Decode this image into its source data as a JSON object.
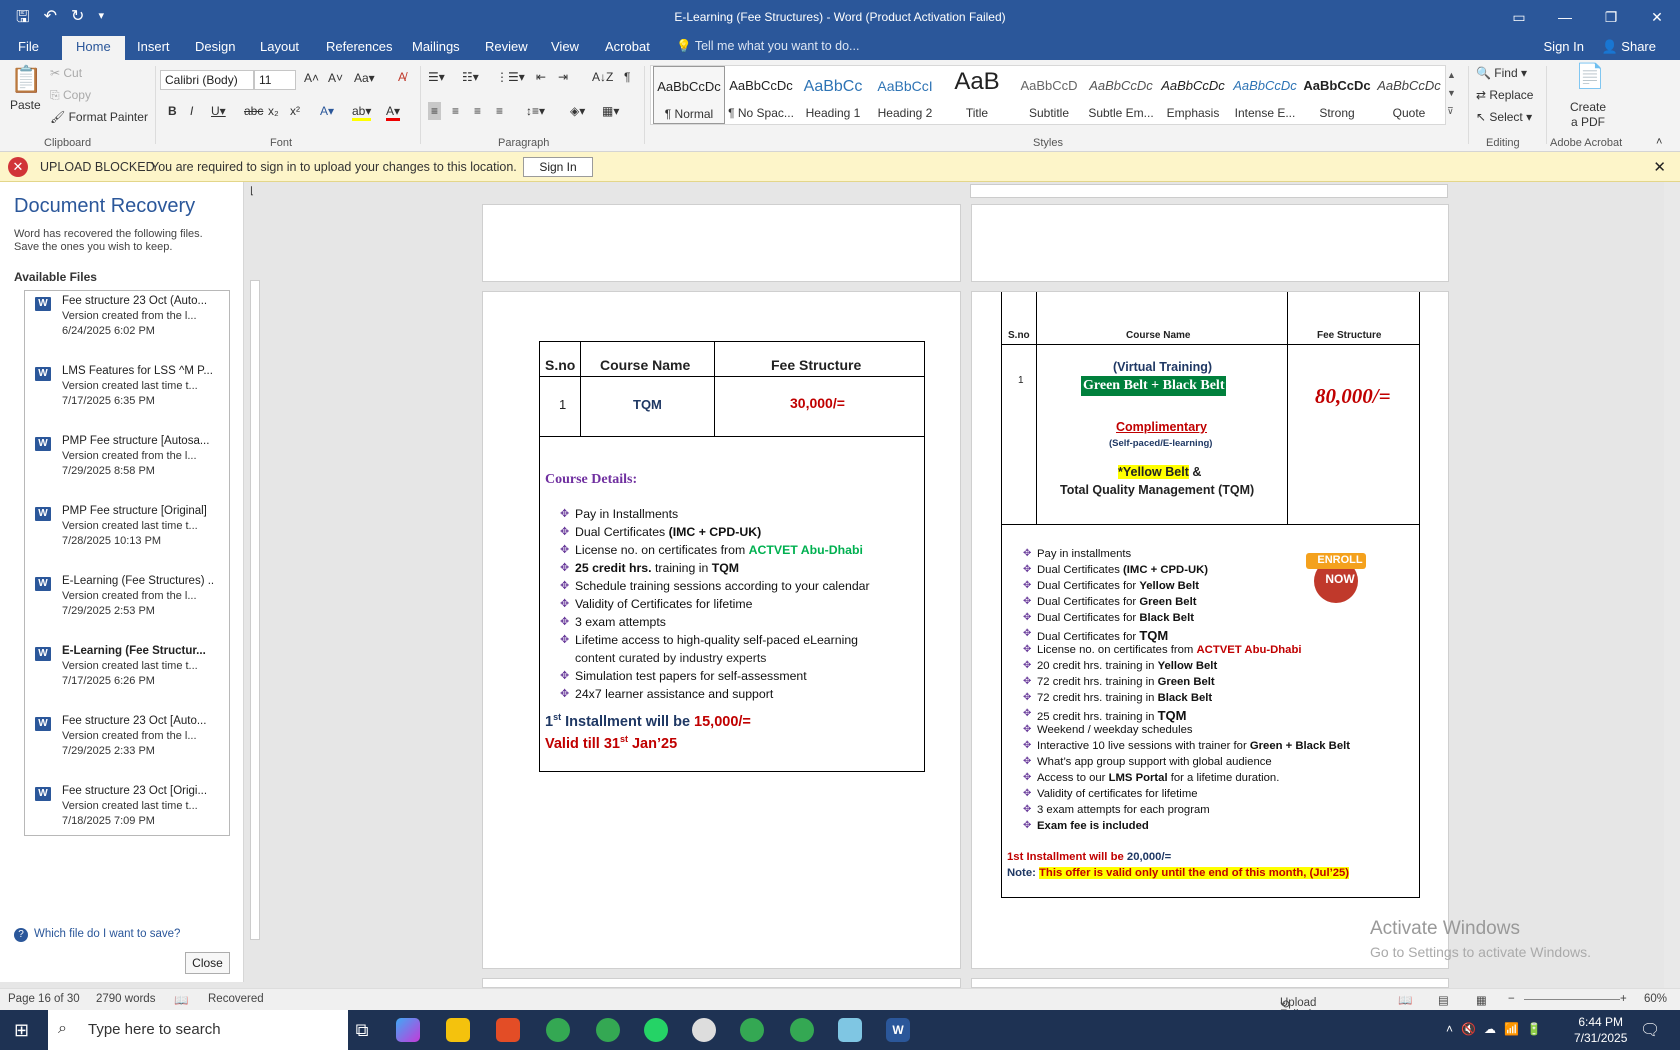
{
  "window": {
    "title": "E-Learning (Fee Structures) - Word (Product Activation Failed)"
  },
  "tabs": [
    "File",
    "Home",
    "Insert",
    "Design",
    "Layout",
    "References",
    "Mailings",
    "Review",
    "View",
    "Acrobat"
  ],
  "tell_me": "Tell me what you want to do...",
  "sign_in": "Sign In",
  "share": "Share",
  "clipboard": {
    "paste": "Paste",
    "cut": "Cut",
    "copy": "Copy",
    "format_painter": "Format Painter",
    "label": "Clipboard"
  },
  "font": {
    "name": "Calibri (Body)",
    "size": "11",
    "label": "Font"
  },
  "paragraph": {
    "label": "Paragraph"
  },
  "styles": {
    "label": "Styles",
    "items": [
      {
        "preview": "AaBbCcDc",
        "name": "¶ Normal"
      },
      {
        "preview": "AaBbCcDc",
        "name": "¶ No Spac..."
      },
      {
        "preview": "AaBbCc",
        "name": "Heading 1"
      },
      {
        "preview": "AaBbCcI",
        "name": "Heading 2"
      },
      {
        "preview": "AaB",
        "name": "Title"
      },
      {
        "preview": "AaBbCcD",
        "name": "Subtitle"
      },
      {
        "preview": "AaBbCcDc",
        "name": "Subtle Em..."
      },
      {
        "preview": "AaBbCcDc",
        "name": "Emphasis"
      },
      {
        "preview": "AaBbCcDc",
        "name": "Intense E..."
      },
      {
        "preview": "AaBbCcDc",
        "name": "Strong"
      },
      {
        "preview": "AaBbCcDc",
        "name": "Quote"
      }
    ]
  },
  "editing": {
    "find": "Find",
    "replace": "Replace",
    "select": "Select",
    "label": "Editing"
  },
  "acrobat": {
    "create_line1": "Create",
    "create_line2": "a PDF",
    "label": "Adobe Acrobat"
  },
  "message_bar": {
    "title": "UPLOAD BLOCKED",
    "text": "You are required to sign in to upload your changes to this location.",
    "button": "Sign In"
  },
  "recovery": {
    "title": "Document Recovery",
    "description": "Word has recovered the following files. Save the ones you wish to keep.",
    "available": "Available Files",
    "files": [
      {
        "name": "Fee structure 23 Oct (Auto...",
        "line2": "Version created from the l...",
        "date": "6/24/2025 6:02 PM",
        "bold": false
      },
      {
        "name": "LMS Features for LSS ^M P...",
        "line2": "Version created last time t...",
        "date": "7/17/2025 6:35 PM",
        "bold": false
      },
      {
        "name": "PMP Fee structure  [Autosa...",
        "line2": "Version created from the l...",
        "date": "7/29/2025 8:58 PM",
        "bold": false
      },
      {
        "name": "PMP Fee structure  [Original]",
        "line2": "Version created last time t...",
        "date": "7/28/2025 10:13 PM",
        "bold": false
      },
      {
        "name": "E-Learning (Fee Structures) ..",
        "line2": "Version created from the l...",
        "date": "7/29/2025 2:53 PM",
        "bold": false
      },
      {
        "name": "E-Learning (Fee Structur...",
        "line2": "Version created last time t...",
        "date": "7/17/2025 6:26 PM",
        "bold": true
      },
      {
        "name": "Fee structure 23 Oct  [Auto...",
        "line2": "Version created from the l...",
        "date": "7/29/2025 2:33 PM",
        "bold": false
      },
      {
        "name": "Fee structure 23 Oct  [Origi...",
        "line2": "Version created last time t...",
        "date": "7/18/2025 7:09 PM",
        "bold": false
      }
    ],
    "help": "Which file do I want to save?",
    "close": "Close"
  },
  "page_left": {
    "headers": [
      "S.no",
      "Course Name",
      "Fee Structure"
    ],
    "row": {
      "sno": "1",
      "course": "TQM",
      "fee": "30,000/="
    },
    "details_title": "Course Details:",
    "bullets": [
      "Pay in Installments",
      "Dual Certificates ",
      "License no. on certificates from ",
      "25 credit hrs.",
      "Schedule training sessions according to your calendar",
      "Validity of Certificates for lifetime",
      "3 exam attempts",
      "Lifetime access to high-quality self-paced eLearning",
      "content curated by industry experts",
      "Simulation test papers for self-assessment",
      "24x7 learner assistance and support"
    ],
    "dual_bold": "(IMC + CPD-UK)",
    "actvet": "ACTVET Abu-Dhabi",
    "credit_rest": " training in ",
    "credit_tqm": "TQM",
    "inst_1": "1",
    "inst_sup": "st",
    "inst_text": " Installment will be ",
    "inst_amount": "15,000/=",
    "valid_1": "Valid till 31",
    "valid_sup": "st",
    "valid_2": " Jan’25"
  },
  "page_right": {
    "headers": [
      "S.no",
      "Course Name",
      "Fee Structure"
    ],
    "sno": "1",
    "virtual": "(Virtual Training)",
    "belts": "Green Belt + Black Belt",
    "fee": "80,000/=",
    "complimentary": "Complimentary",
    "selfpaced": "(Self-paced/E-learning)",
    "yellow": "*Yellow Belt",
    "amp": " &",
    "tqm_line": "Total Quality Management (TQM)",
    "enroll_1": "ENROLL",
    "enroll_2": "NOW",
    "bullets": [
      {
        "a": "Pay in installments",
        "b": ""
      },
      {
        "a": "Dual Certificates ",
        "b": "(IMC + CPD-UK)"
      },
      {
        "a": "Dual Certificates for ",
        "b": "Yellow Belt"
      },
      {
        "a": "Dual Certificates for ",
        "b": "Green Belt"
      },
      {
        "a": "Dual Certificates for ",
        "b": "Black Belt"
      },
      {
        "a": "Dual Certificates for  ",
        "b": "TQM"
      },
      {
        "a": "License no. on certificates from ",
        "b": "ACTVET Abu-Dhabi"
      },
      {
        "a": "20 credit hrs. training in ",
        "b": "Yellow Belt"
      },
      {
        "a": "72 credit hrs. training in ",
        "b": "Green Belt"
      },
      {
        "a": "72 credit hrs. training in ",
        "b": "Black Belt"
      },
      {
        "a": "25 credit hrs. training in  ",
        "b": "TQM"
      },
      {
        "a": " Weekend / weekday schedules",
        "b": ""
      },
      {
        "a": "Interactive 10 live sessions with trainer for ",
        "b": "Green + Black Belt"
      },
      {
        "a": "What’s app group support with global audience",
        "b": ""
      },
      {
        "a": "Access to our ",
        "b": "LMS Portal"
      },
      {
        "a": "Validity of certificates for lifetime",
        "b": ""
      },
      {
        "a": "3 exam attempts for each program",
        "b": ""
      },
      {
        "a": "",
        "b": "Exam fee is included"
      }
    ],
    "lms_rest": " for a lifetime duration.",
    "inst_label": "1st Installment will be ",
    "inst_amount": "20,000/=",
    "note_label": "Note: ",
    "note_text": "This offer is valid only until the end of this month, (Jul’25)"
  },
  "watermark": {
    "line1": "Activate Windows",
    "line2": "Go to Settings to activate Windows."
  },
  "status": {
    "page": "Page 16 of 30",
    "words": "2790 words",
    "recovered": "Recovered",
    "upload": "Upload Failed",
    "zoom": "60%"
  },
  "taskbar": {
    "search": "Type here to search",
    "time": "6:44 PM",
    "date": "7/31/2025"
  }
}
